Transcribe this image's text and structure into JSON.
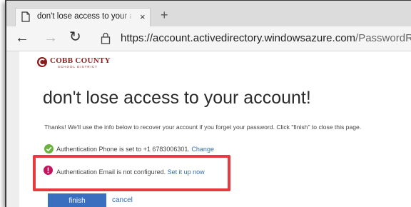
{
  "browser": {
    "tab": {
      "title": "don't lose access to your accoun",
      "close_glyph": "×",
      "new_tab_glyph": "+"
    },
    "nav": {
      "back_glyph": "←",
      "forward_glyph": "→",
      "refresh_glyph": "↻"
    },
    "address": {
      "scheme_host": "https://account.activedirectory.windowsazure.com",
      "path": "/PasswordReset/Regist"
    }
  },
  "logo": {
    "text": "COBB COUNTY",
    "subtext": "SCHOOL DISTRICT",
    "color": "#8a1c1c"
  },
  "main": {
    "heading": "don't lose access to your account!",
    "intro": "Thanks! We'll use the info below to recover your account if you forget your password. Click \"finish\" to close this page.",
    "phone": {
      "icon": "check-circle-icon",
      "text": "Authentication Phone is set to +1 6783006301.",
      "action": "Change",
      "status_color": "#6bb33f"
    },
    "email": {
      "icon": "alert-circle-icon",
      "text": "Authentication Email is not configured.",
      "action": "Set it up now",
      "status_color": "#c4145e"
    },
    "finish_label": "finish",
    "cancel_label": "cancel"
  },
  "colors": {
    "highlight": "#e53a3f",
    "link": "#2f6ab5",
    "primary_button": "#3a6fc0"
  }
}
